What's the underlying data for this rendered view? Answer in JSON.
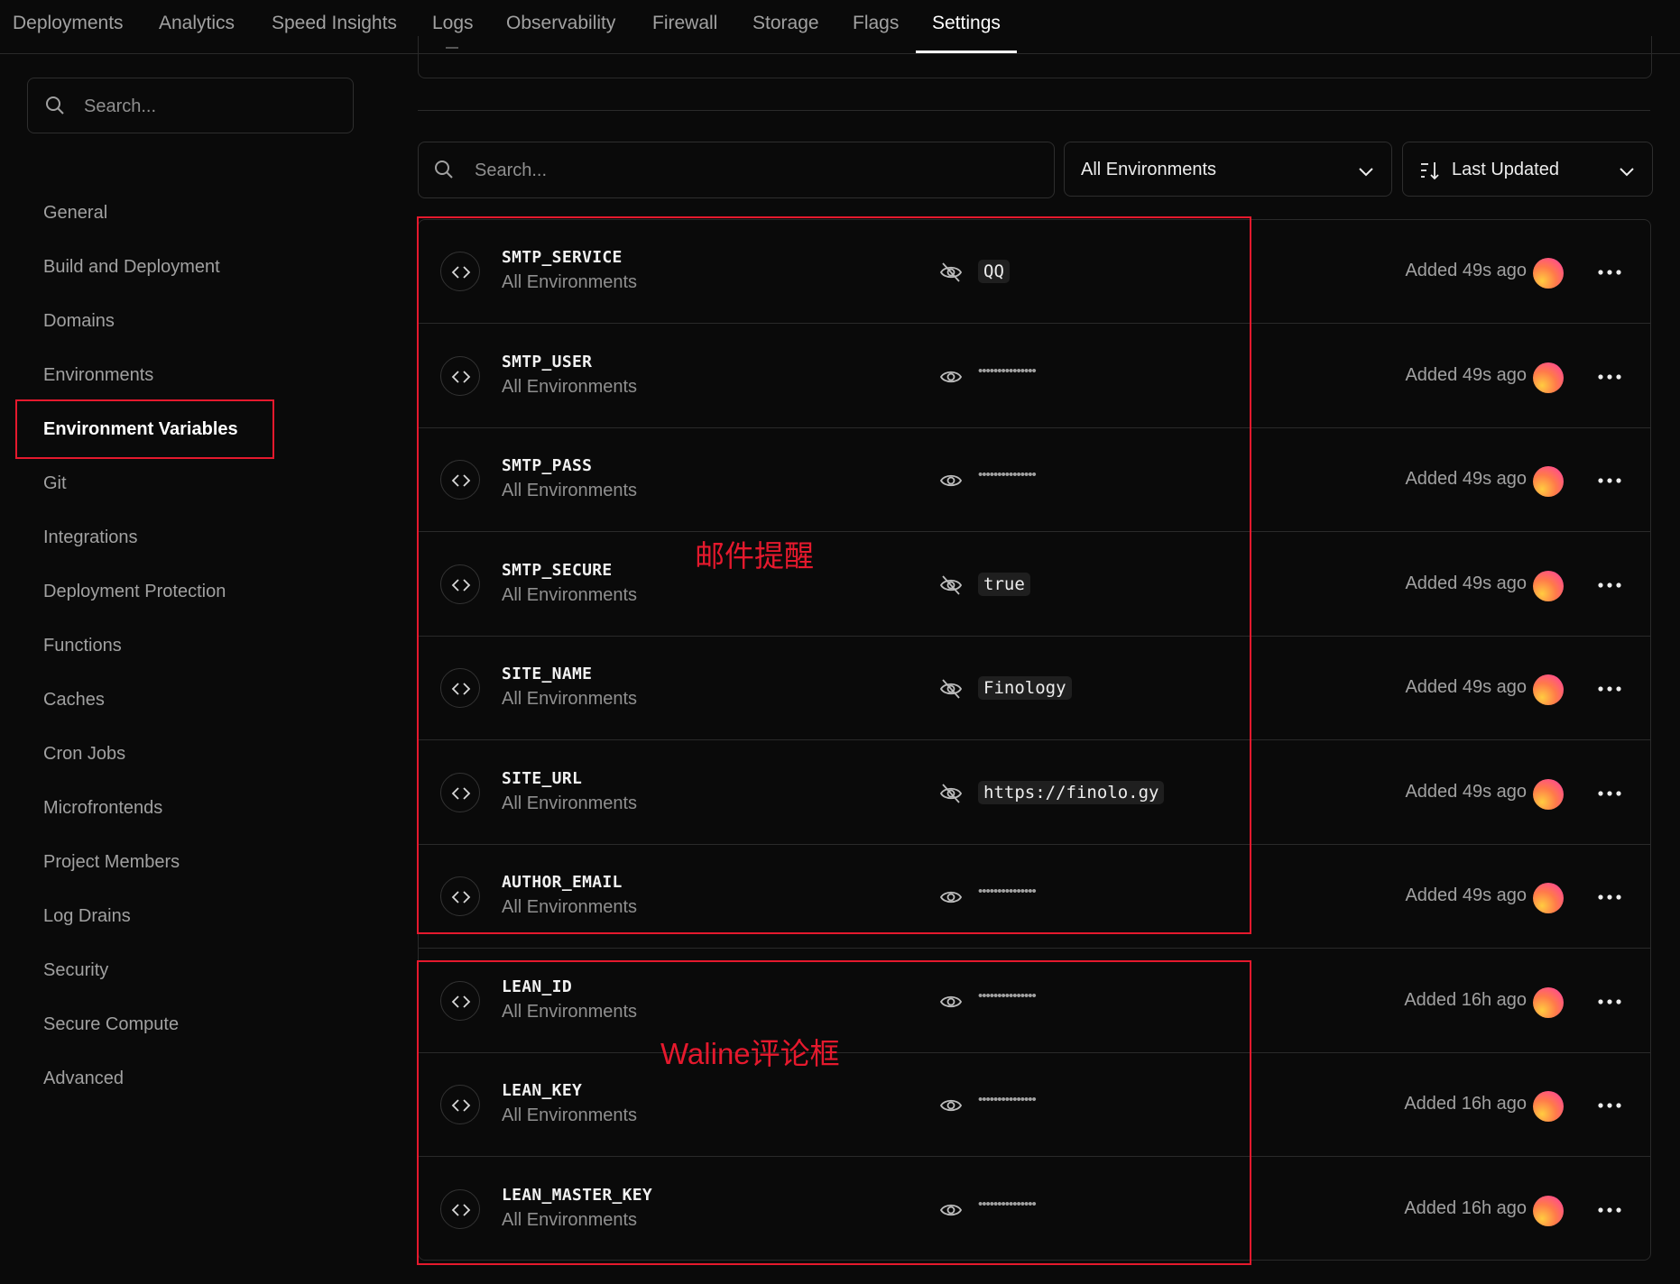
{
  "nav": {
    "tabs": [
      {
        "label": "Deployments",
        "active": false
      },
      {
        "label": "Analytics",
        "active": false
      },
      {
        "label": "Speed Insights",
        "active": false
      },
      {
        "label": "Logs",
        "active": false
      },
      {
        "label": "Observability",
        "active": false
      },
      {
        "label": "Firewall",
        "active": false
      },
      {
        "label": "Storage",
        "active": false
      },
      {
        "label": "Flags",
        "active": false
      },
      {
        "label": "Settings",
        "active": true
      }
    ]
  },
  "sidebar": {
    "search_placeholder": "Search...",
    "items": [
      {
        "label": "General",
        "active": false
      },
      {
        "label": "Build and Deployment",
        "active": false
      },
      {
        "label": "Domains",
        "active": false
      },
      {
        "label": "Environments",
        "active": false
      },
      {
        "label": "Environment Variables",
        "active": true
      },
      {
        "label": "Git",
        "active": false
      },
      {
        "label": "Integrations",
        "active": false
      },
      {
        "label": "Deployment Protection",
        "active": false
      },
      {
        "label": "Functions",
        "active": false
      },
      {
        "label": "Caches",
        "active": false
      },
      {
        "label": "Cron Jobs",
        "active": false
      },
      {
        "label": "Microfrontends",
        "active": false
      },
      {
        "label": "Project Members",
        "active": false
      },
      {
        "label": "Log Drains",
        "active": false
      },
      {
        "label": "Security",
        "active": false
      },
      {
        "label": "Secure Compute",
        "active": false
      },
      {
        "label": "Advanced",
        "active": false
      }
    ]
  },
  "filters": {
    "search_placeholder": "Search...",
    "environment_select": "All Environments",
    "sort_select": "Last Updated"
  },
  "variables": [
    {
      "key": "SMTP_SERVICE",
      "environment": "All Environments",
      "visible": true,
      "value": "QQ",
      "added": "Added 49s ago"
    },
    {
      "key": "SMTP_USER",
      "environment": "All Environments",
      "visible": false,
      "value": "•••••••••••••••",
      "added": "Added 49s ago"
    },
    {
      "key": "SMTP_PASS",
      "environment": "All Environments",
      "visible": false,
      "value": "•••••••••••••••",
      "added": "Added 49s ago"
    },
    {
      "key": "SMTP_SECURE",
      "environment": "All Environments",
      "visible": true,
      "value": "true",
      "added": "Added 49s ago"
    },
    {
      "key": "SITE_NAME",
      "environment": "All Environments",
      "visible": true,
      "value": "Finology",
      "added": "Added 49s ago"
    },
    {
      "key": "SITE_URL",
      "environment": "All Environments",
      "visible": true,
      "value": "https://finolo.gy",
      "added": "Added 49s ago"
    },
    {
      "key": "AUTHOR_EMAIL",
      "environment": "All Environments",
      "visible": false,
      "value": "•••••••••••••••",
      "added": "Added 49s ago"
    },
    {
      "key": "LEAN_ID",
      "environment": "All Environments",
      "visible": false,
      "value": "•••••••••••••••",
      "added": "Added 16h ago"
    },
    {
      "key": "LEAN_KEY",
      "environment": "All Environments",
      "visible": false,
      "value": "•••••••••••••••",
      "added": "Added 16h ago"
    },
    {
      "key": "LEAN_MASTER_KEY",
      "environment": "All Environments",
      "visible": false,
      "value": "•••••••••••••••",
      "added": "Added 16h ago"
    }
  ],
  "annotations": [
    {
      "text": "邮件提醒"
    },
    {
      "text": "Waline评论框"
    }
  ],
  "colors": {
    "background": "#0a0a0a",
    "border": "#2a2a2a",
    "muted_text": "#a1a1a1",
    "annotation_red": "#e5192d"
  },
  "icons": {
    "search": "search-icon",
    "chevron": "chevron-down-icon",
    "sort": "sort-icon",
    "code": "code-icon",
    "eye": "eye-icon",
    "eye_off": "eye-off-icon",
    "more": "more-icon",
    "avatar": "avatar"
  }
}
